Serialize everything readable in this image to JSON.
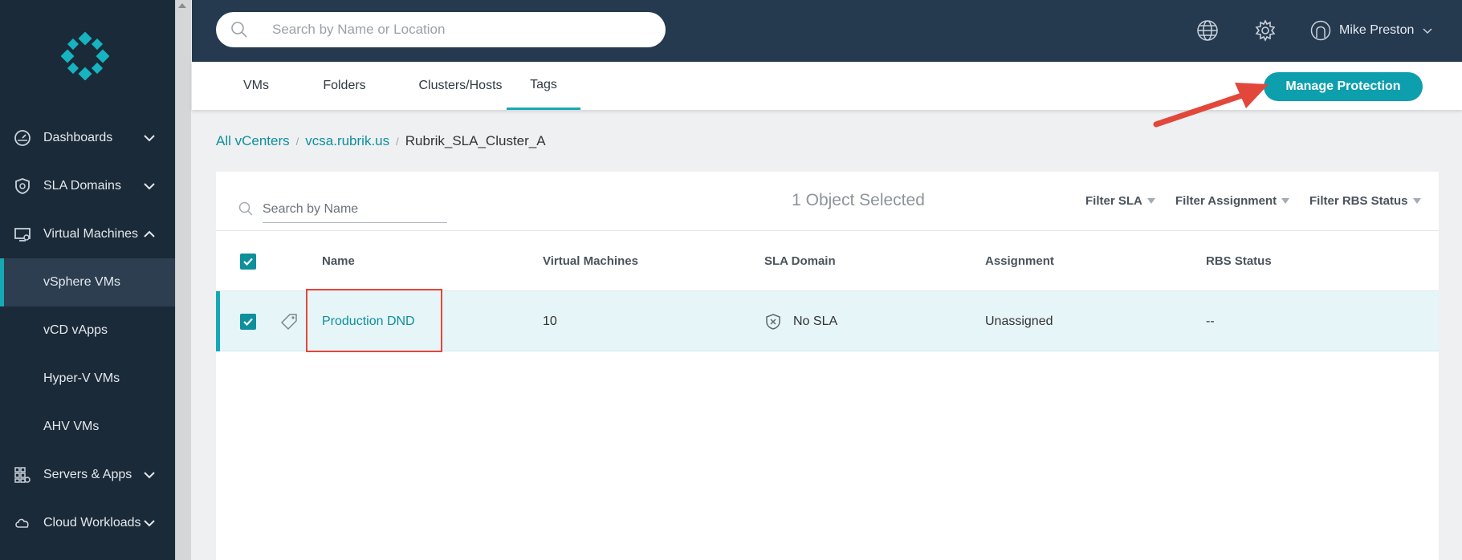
{
  "sidebar": {
    "items": [
      {
        "label": "Dashboards",
        "icon": "dashboard-icon"
      },
      {
        "label": "SLA Domains",
        "icon": "shield-icon"
      },
      {
        "label": "Virtual Machines",
        "icon": "monitor-icon"
      },
      {
        "label": "Servers & Apps",
        "icon": "apps-grid-icon"
      },
      {
        "label": "Cloud Workloads",
        "icon": "cloud-icon"
      }
    ],
    "sub_items": [
      {
        "label": "vSphere VMs",
        "active": true
      },
      {
        "label": "vCD vApps"
      },
      {
        "label": "Hyper-V VMs"
      },
      {
        "label": "AHV VMs"
      }
    ]
  },
  "header": {
    "search_placeholder": "Search by Name or Location",
    "user_name": "Mike Preston"
  },
  "tabs": [
    {
      "label": "VMs"
    },
    {
      "label": "Folders"
    },
    {
      "label": "Clusters/Hosts"
    },
    {
      "label": "Tags",
      "active": true
    }
  ],
  "manage_protection_label": "Manage Protection",
  "breadcrumb": {
    "items": [
      "All vCenters",
      "vcsa.rubrik.us"
    ],
    "current": "Rubrik_SLA_Cluster_A",
    "separator": "/"
  },
  "table": {
    "search_placeholder": "Search by Name",
    "selected_count": "1 Object Selected",
    "filters": [
      "Filter SLA",
      "Filter Assignment",
      "Filter RBS Status"
    ],
    "columns": [
      "Name",
      "Virtual Machines",
      "SLA Domain",
      "Assignment",
      "RBS Status"
    ],
    "rows": [
      {
        "name": "Production DND",
        "virtual_machines": "10",
        "sla_domain": "No SLA",
        "assignment": "Unassigned",
        "rbs_status": "--",
        "selected": true
      }
    ]
  },
  "colors": {
    "accent": "#14a9b5",
    "sidebar_bg": "#1b2a38",
    "header_bg": "#25394f",
    "annotation_red": "#e2473b"
  }
}
